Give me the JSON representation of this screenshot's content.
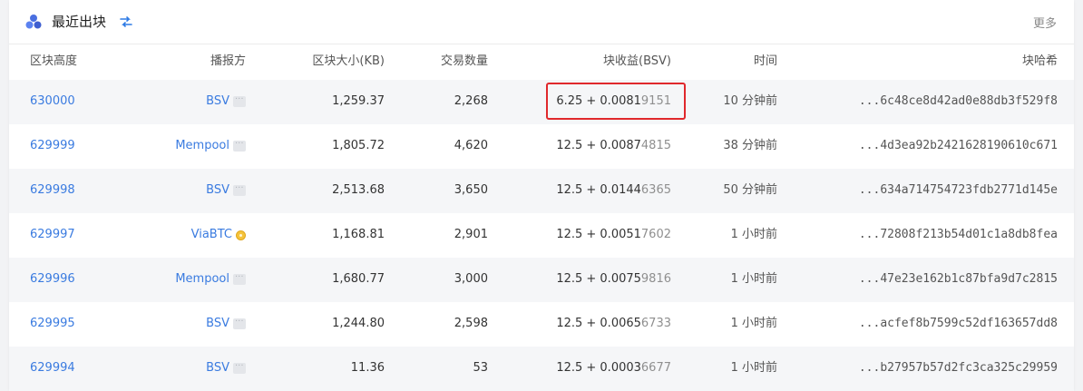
{
  "header": {
    "title": "最近出块",
    "more_label": "更多"
  },
  "columns": {
    "height": "区块高度",
    "miner": "播报方",
    "size": "区块大小(KB)",
    "tx_count": "交易数量",
    "reward": "块收益(BSV)",
    "time": "时间",
    "hash": "块哈希"
  },
  "rows": [
    {
      "height": "630000",
      "miner": "BSV",
      "miner_icon": "dots-icon",
      "size": "1,259.37",
      "tx_count": "2,268",
      "reward_main": "6.25 + 0.0081",
      "reward_dim": "9151",
      "time": "10 分钟前",
      "hash": "...6c48ce8d42ad0e88db3f529f8"
    },
    {
      "height": "629999",
      "miner": "Mempool",
      "miner_icon": "dots-icon",
      "size": "1,805.72",
      "tx_count": "4,620",
      "reward_main": "12.5 + 0.0087",
      "reward_dim": "4815",
      "time": "38 分钟前",
      "hash": "...4d3ea92b2421628190610c671"
    },
    {
      "height": "629998",
      "miner": "BSV",
      "miner_icon": "dots-icon",
      "size": "2,513.68",
      "tx_count": "3,650",
      "reward_main": "12.5 + 0.0144",
      "reward_dim": "6365",
      "time": "50 分钟前",
      "hash": "...634a714754723fdb2771d145e"
    },
    {
      "height": "629997",
      "miner": "ViaBTC",
      "miner_icon": "coin-icon",
      "size": "1,168.81",
      "tx_count": "2,901",
      "reward_main": "12.5 + 0.0051",
      "reward_dim": "7602",
      "time": "1 小时前",
      "hash": "...72808f213b54d01c1a8db8fea"
    },
    {
      "height": "629996",
      "miner": "Mempool",
      "miner_icon": "dots-icon",
      "size": "1,680.77",
      "tx_count": "3,000",
      "reward_main": "12.5 + 0.0075",
      "reward_dim": "9816",
      "time": "1 小时前",
      "hash": "...47e23e162b1c87bfa9d7c2815"
    },
    {
      "height": "629995",
      "miner": "BSV",
      "miner_icon": "dots-icon",
      "size": "1,244.80",
      "tx_count": "2,598",
      "reward_main": "12.5 + 0.0065",
      "reward_dim": "6733",
      "time": "1 小时前",
      "hash": "...acfef8b7599c52df163657dd8"
    },
    {
      "height": "629994",
      "miner": "BSV",
      "miner_icon": "dots-icon",
      "size": "11.36",
      "tx_count": "53",
      "reward_main": "12.5 + 0.0003",
      "reward_dim": "6677",
      "time": "1 小时前",
      "hash": "...b27957b57d2fc3ca325c29959"
    }
  ],
  "colors": {
    "link": "#3a7be0",
    "highlight_border": "#e0282c",
    "row_alt": "#f5f6f8"
  }
}
